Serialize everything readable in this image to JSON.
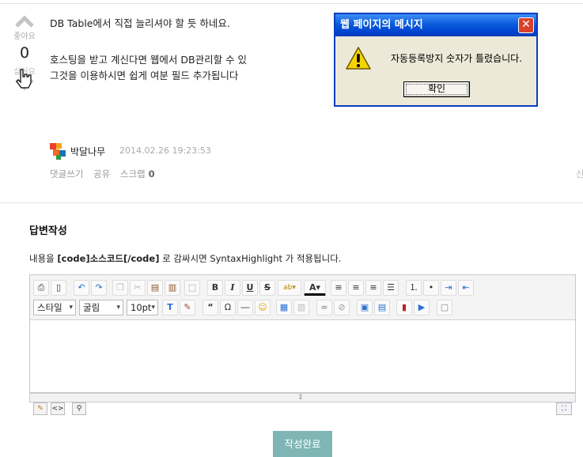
{
  "post": {
    "like_label": "좋아요",
    "vote_count": "0",
    "dislike_label": "싫어요",
    "answer_lines": [
      "DB Table에서 직접 늘리셔야 할 듯 하네요.",
      "호스팅을 받고 계신다면 웹에서 DB관리할 수 있",
      "그것을 이용하시면 쉽게 여분 필드 추가됩니다"
    ],
    "author": "박달나무",
    "date": "2014.02.26 19:23:53",
    "actions": {
      "comment": "댓글쓰기",
      "share": "공유",
      "scrap": "스크랩",
      "scrap_count": "0"
    },
    "right_edge_text": "신"
  },
  "dialog": {
    "title": "웹 페이지의 메시지",
    "message": "자동등록방지 숫자가 틀렸습니다.",
    "ok_label": "확인",
    "close_glyph": "✕"
  },
  "reply": {
    "section_title": "답변작성",
    "hint_prefix": "내용을 ",
    "hint_code": "[code]소스코드[/code]",
    "hint_suffix": " 로 감싸시면 SyntaxHighlight 가 적용됩니다.",
    "style_select": "스타일",
    "font_select": "굴림",
    "size_select": "10pt",
    "submit_label": "작성완료"
  },
  "colors": {
    "dialog_title": "#0a5bdc",
    "submit_bg": "#7fb5b5",
    "warning": "#f5d400"
  }
}
